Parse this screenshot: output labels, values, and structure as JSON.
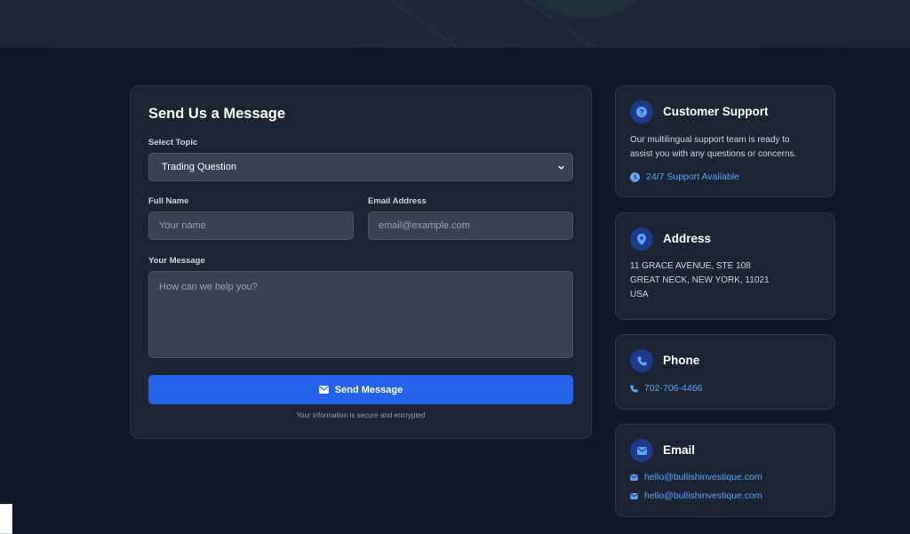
{
  "form": {
    "title": "Send Us a Message",
    "topic_label": "Select Topic",
    "topic_value": "Trading Question",
    "name_label": "Full Name",
    "name_placeholder": "Your name",
    "email_label": "Email Address",
    "email_placeholder": "email@example.com",
    "message_label": "Your Message",
    "message_placeholder": "How can we help you?",
    "submit_label": "Send Message",
    "secure_note": "Your information is secure and encrypted"
  },
  "support": {
    "title": "Customer Support",
    "description_line1": "Our multilingual support team is ready to",
    "description_line2": "assist you with any questions or concerns.",
    "availability": "24/7 Support Available"
  },
  "address": {
    "title": "Address",
    "line1": "11 GRACE AVENUE, STE 108",
    "line2": "GREAT NECK, NEW YORK, 11021",
    "line3": "USA"
  },
  "phone": {
    "title": "Phone",
    "number": "702-706-4466"
  },
  "email": {
    "title": "Email",
    "addresses": [
      "hello@bullishinvestique.com",
      "hello@bullishinvestique.com"
    ]
  },
  "colors": {
    "page_bg": "#0f1626",
    "card_bg": "#1c2433",
    "accent": "#2563eb",
    "link": "#60a5fa",
    "icon_bg": "#1e3a8a"
  }
}
